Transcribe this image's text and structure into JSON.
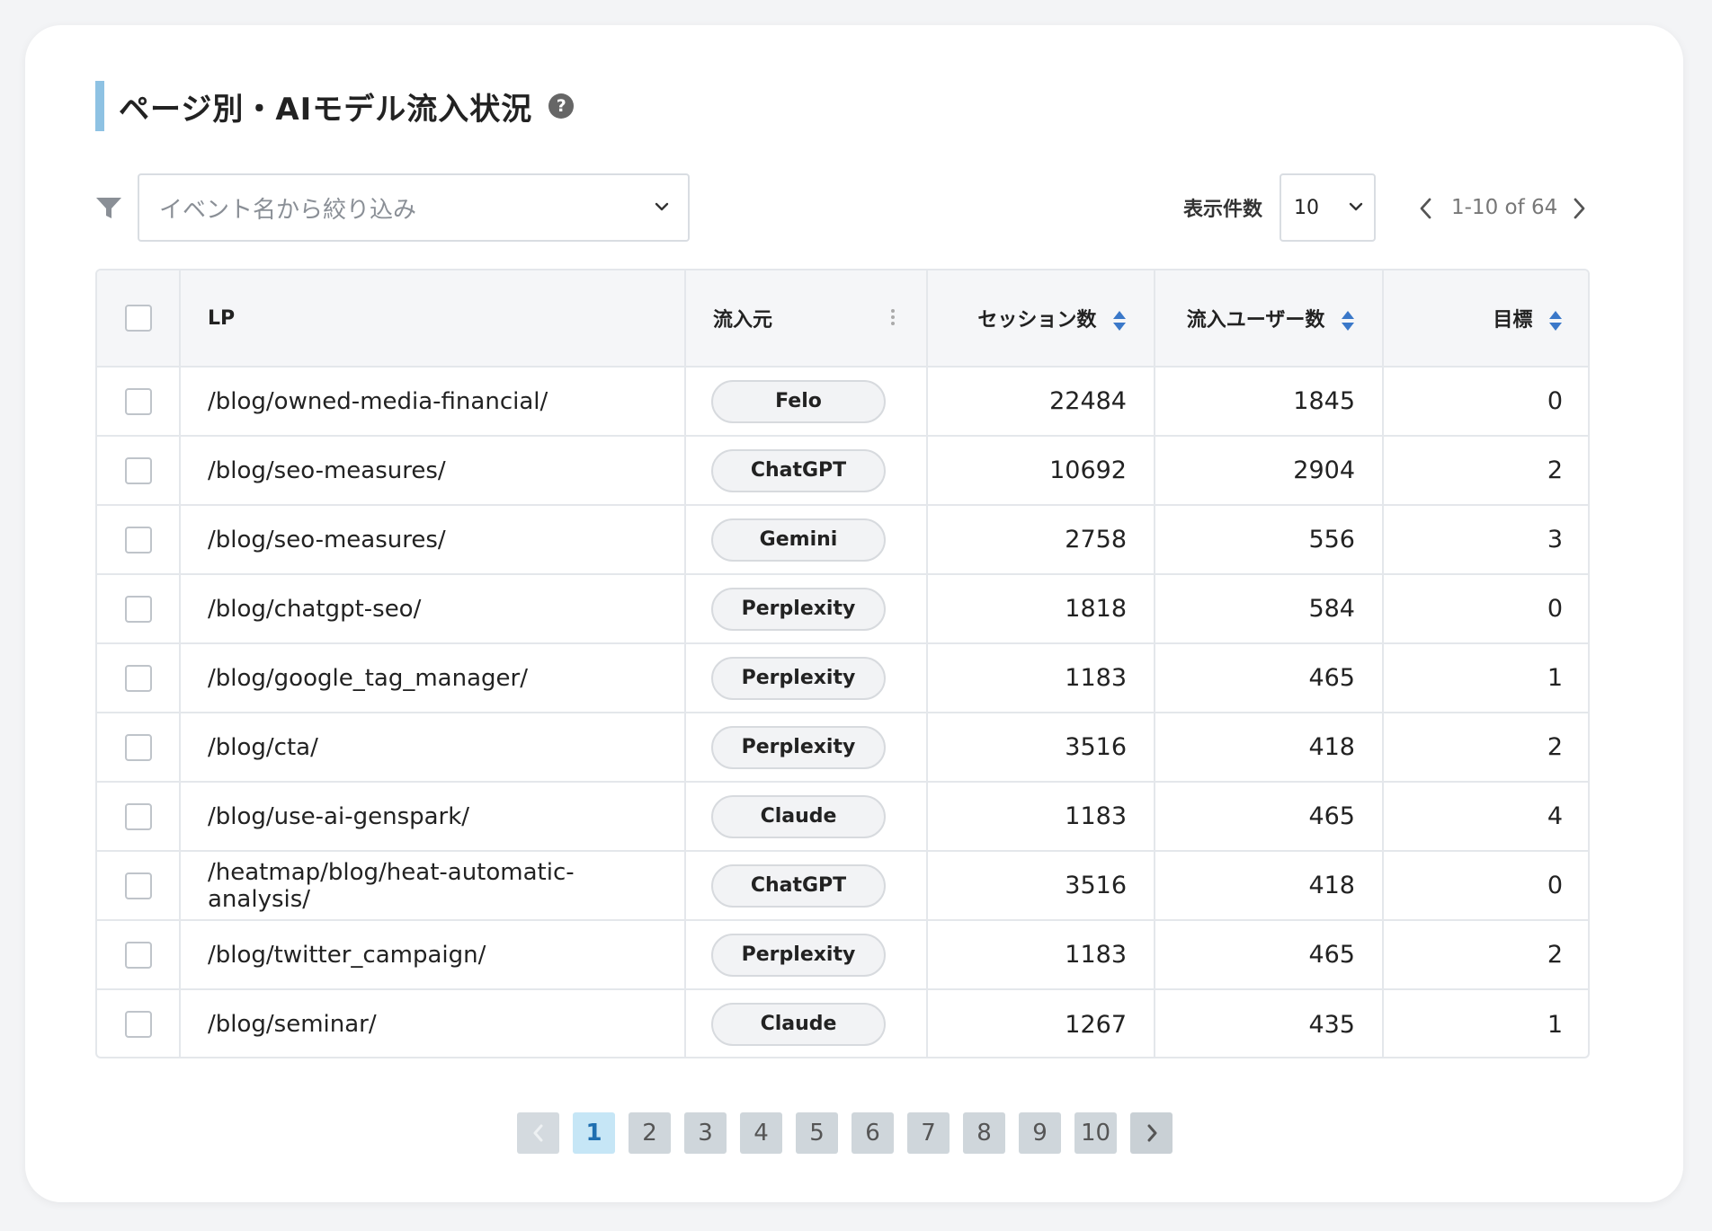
{
  "header": {
    "title": "ページ別・AIモデル流入状況",
    "help_icon": "?"
  },
  "filter": {
    "placeholder": "イベント名から絞り込み"
  },
  "pagination_top": {
    "per_page_label": "表示件数",
    "per_page_value": "10",
    "range_text": "1-10 of 64"
  },
  "table": {
    "headers": {
      "lp": "LP",
      "source": "流入元",
      "sessions": "セッション数",
      "users": "流入ユーザー数",
      "goals": "目標"
    },
    "rows": [
      {
        "lp": "/blog/owned-media-financial/",
        "source": "Felo",
        "sessions": "22484",
        "users": "1845",
        "goals": "0"
      },
      {
        "lp": "/blog/seo-measures/",
        "source": "ChatGPT",
        "sessions": "10692",
        "users": "2904",
        "goals": "2"
      },
      {
        "lp": "/blog/seo-measures/",
        "source": "Gemini",
        "sessions": "2758",
        "users": "556",
        "goals": "3"
      },
      {
        "lp": "/blog/chatgpt-seo/",
        "source": "Perplexity",
        "sessions": "1818",
        "users": "584",
        "goals": "0"
      },
      {
        "lp": "/blog/google_tag_manager/",
        "source": "Perplexity",
        "sessions": "1183",
        "users": "465",
        "goals": "1"
      },
      {
        "lp": "/blog/cta/",
        "source": "Perplexity",
        "sessions": "3516",
        "users": "418",
        "goals": "2"
      },
      {
        "lp": "/blog/use-ai-genspark/",
        "source": "Claude",
        "sessions": "1183",
        "users": "465",
        "goals": "4"
      },
      {
        "lp": "/heatmap/blog/heat-automatic-analysis/",
        "source": "ChatGPT",
        "sessions": "3516",
        "users": "418",
        "goals": "0"
      },
      {
        "lp": "/blog/twitter_campaign/",
        "source": "Perplexity",
        "sessions": "1183",
        "users": "465",
        "goals": "2"
      },
      {
        "lp": "/blog/seminar/",
        "source": "Claude",
        "sessions": "1267",
        "users": "435",
        "goals": "1"
      }
    ]
  },
  "pagination_bottom": {
    "pages": [
      "1",
      "2",
      "3",
      "4",
      "5",
      "6",
      "7",
      "8",
      "9",
      "10"
    ],
    "current": "1"
  },
  "colors": {
    "title_accent": "#8ec2e3",
    "sort_icon": "#3a78c9",
    "active_page_bg": "#c6e6f6",
    "active_page_text": "#1f6fb0"
  }
}
